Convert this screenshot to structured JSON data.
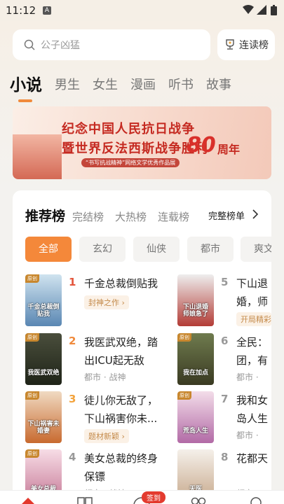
{
  "status": {
    "time": "11:12"
  },
  "search": {
    "placeholder": "公子凶猛"
  },
  "rank_button": {
    "label": "连读榜"
  },
  "tabs": [
    "小说",
    "男生",
    "女生",
    "漫画",
    "听书",
    "故事"
  ],
  "banner": {
    "line1": "纪念中国人民抗日战争",
    "line2": "暨世界反法西斯战争胜利",
    "number": "80",
    "suffix": "周年",
    "tag": "“书写抗战精神”网络文学优秀作品展"
  },
  "ranking": {
    "tabs": [
      "推荐榜",
      "完结榜",
      "大热榜",
      "连载榜"
    ],
    "full_label": "完整榜单",
    "chips": [
      "全部",
      "玄幻",
      "仙侠",
      "都市",
      "爽文"
    ]
  },
  "books_left": [
    {
      "rank": "1",
      "title": "千金总裁倒贴我",
      "tag": "封神之作",
      "meta": "",
      "badge": "原创",
      "cover_title": "千金总裁倒贴我"
    },
    {
      "rank": "2",
      "title": "我医武双绝，踏出ICU起无敌",
      "tag": "",
      "meta": "都市 · 战神",
      "badge": "原创",
      "cover_title": "我医武双绝"
    },
    {
      "rank": "3",
      "title": "徒儿你无敌了，下山祸害你未...",
      "tag": "题材新颖",
      "meta": "",
      "badge": "原创",
      "cover_title": "下山祸害未婚妻"
    },
    {
      "rank": "4",
      "title": "美女总裁的终身保镖",
      "tag": "",
      "meta": "都市 · 战神",
      "badge": "原创",
      "cover_title": "美女总裁"
    }
  ],
  "books_right": [
    {
      "rank": "5",
      "title": "下山退婚，师娘急了",
      "tag": "开局精彩",
      "meta": "",
      "badge": "",
      "cover_title": "下山退婚 师娘急了"
    },
    {
      "rank": "6",
      "title": "全民：团，有",
      "tag": "",
      "meta": "都市 ·",
      "badge": "原创",
      "cover_title": "我在加点"
    },
    {
      "rank": "7",
      "title": "我和女岛人生",
      "tag": "",
      "meta": "都市 ·",
      "badge": "原创",
      "cover_title": "荒岛人生"
    },
    {
      "rank": "8",
      "title": "花都天",
      "tag": "",
      "meta": "都市 ·",
      "badge": "",
      "cover_title": "天医"
    }
  ],
  "bottom": {
    "signin": "签到"
  }
}
